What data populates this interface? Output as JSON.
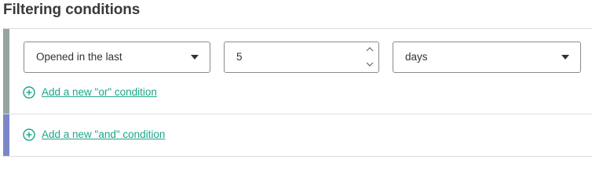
{
  "title": "Filtering conditions",
  "or_group": {
    "condition": {
      "field_label": "Opened in the last",
      "number_value": "5",
      "unit_label": "days"
    },
    "add_or_label": "Add a new \"or\" condition"
  },
  "and_group": {
    "add_and_label": "Add a new \"and\" condition"
  },
  "colors": {
    "or_bar": "#95a5a1",
    "and_bar": "#7b87c9",
    "link": "#1aa687"
  },
  "icons": {
    "add": "plus-circle-icon",
    "select_caret": "caret-down-icon",
    "spin_up": "chevron-up-icon",
    "spin_down": "chevron-down-icon"
  }
}
